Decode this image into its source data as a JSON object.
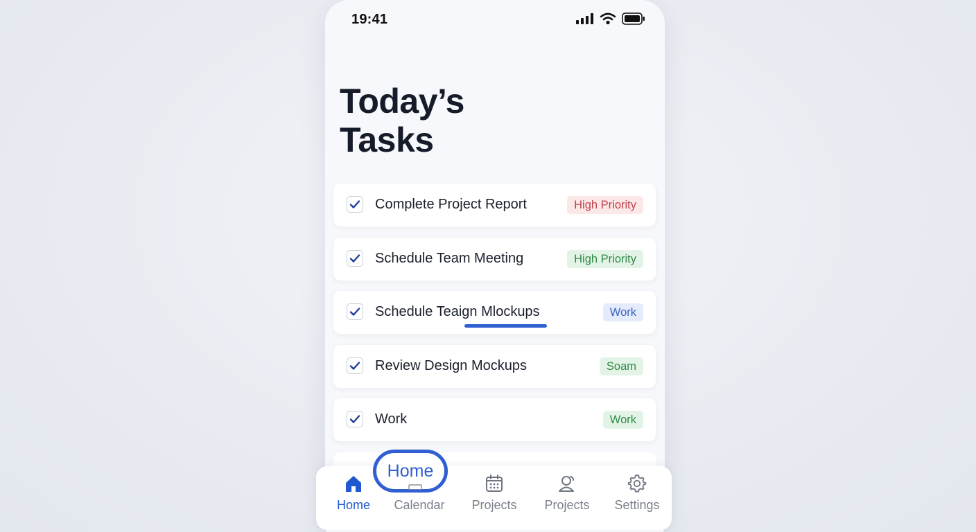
{
  "status_bar": {
    "time": "19:41",
    "icons": [
      "signal-icon",
      "wifi-icon",
      "battery-icon"
    ]
  },
  "page": {
    "title_line1": "Today’s",
    "title_line2": "Tasks"
  },
  "tasks": [
    {
      "title": "Complete Project Report",
      "tag": "High Priority",
      "tag_color": "red",
      "checked": true
    },
    {
      "title": "Schedule Team Meeting",
      "tag": "High Priority",
      "tag_color": "green",
      "checked": true
    },
    {
      "title": "Schedule Teaign Mlockups",
      "tag": "Work",
      "tag_color": "blue",
      "checked": true
    },
    {
      "title": "Review Design Mockups",
      "tag": "Soam",
      "tag_color": "green",
      "checked": true
    },
    {
      "title": "Work",
      "tag": "Work",
      "tag_color": "green",
      "checked": true
    }
  ],
  "tab_bar": {
    "bubble_label": "Home",
    "tabs": [
      {
        "label": "Home",
        "icon": "home-icon",
        "active": true
      },
      {
        "label": "Calendar",
        "icon": "calendar-icon",
        "active": false
      },
      {
        "label": "Projects",
        "icon": "calendar-grid-icon",
        "active": false
      },
      {
        "label": "Projects",
        "icon": "user-icon",
        "active": false
      },
      {
        "label": "Settings",
        "icon": "gear-icon",
        "active": false
      }
    ]
  },
  "colors": {
    "accent": "#1f58d0",
    "tag_red_bg": "#fde8e8",
    "tag_green_bg": "#e3f4e7",
    "tag_blue_bg": "#e4ebfa"
  }
}
